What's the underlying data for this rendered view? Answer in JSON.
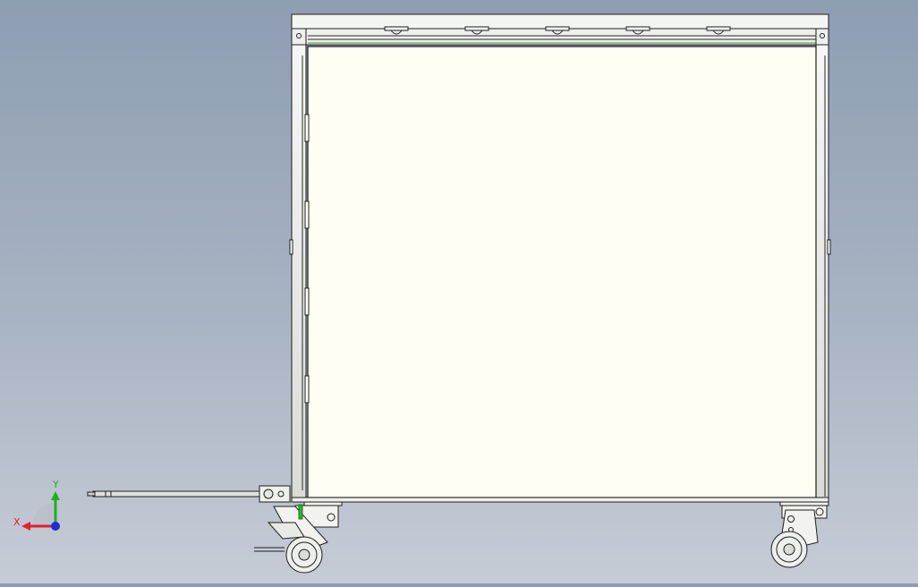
{
  "viewport": {
    "background_top": "#8e9db2",
    "background_bottom": "#c6ccd6",
    "panel_fill": "#fefef2",
    "frame_fill": "#f4f6f2",
    "edge_color": "#1e1e1e"
  },
  "triad": {
    "x_label": "X",
    "y_label": "Y",
    "x_color": "#e2202a",
    "y_color": "#18b418",
    "z_color": "#1c2fd6"
  },
  "model": {
    "description_icon": "trolley-cart-model",
    "top_clips": 5,
    "wheels": 2
  }
}
